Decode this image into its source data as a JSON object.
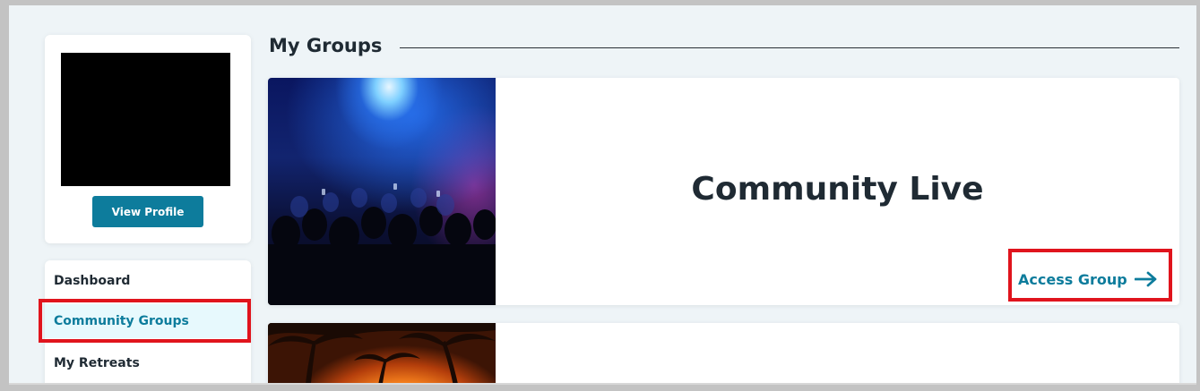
{
  "sidebar": {
    "view_profile_label": "View Profile",
    "nav": [
      {
        "label": "Dashboard"
      },
      {
        "label": "Community Groups"
      },
      {
        "label": "My Retreats"
      }
    ]
  },
  "main": {
    "section_title": "My Groups",
    "groups": [
      {
        "title": "Community Live",
        "action_label": "Access Group",
        "image": "concert-crowd-photo"
      },
      {
        "title": "",
        "image": "tropical-sunset-palms-photo"
      }
    ]
  },
  "colors": {
    "accent": "#0d7c9c",
    "highlight_box": "#e0141d",
    "active_nav_bg": "#e7f9fd",
    "page_bg": "#eef4f7"
  }
}
